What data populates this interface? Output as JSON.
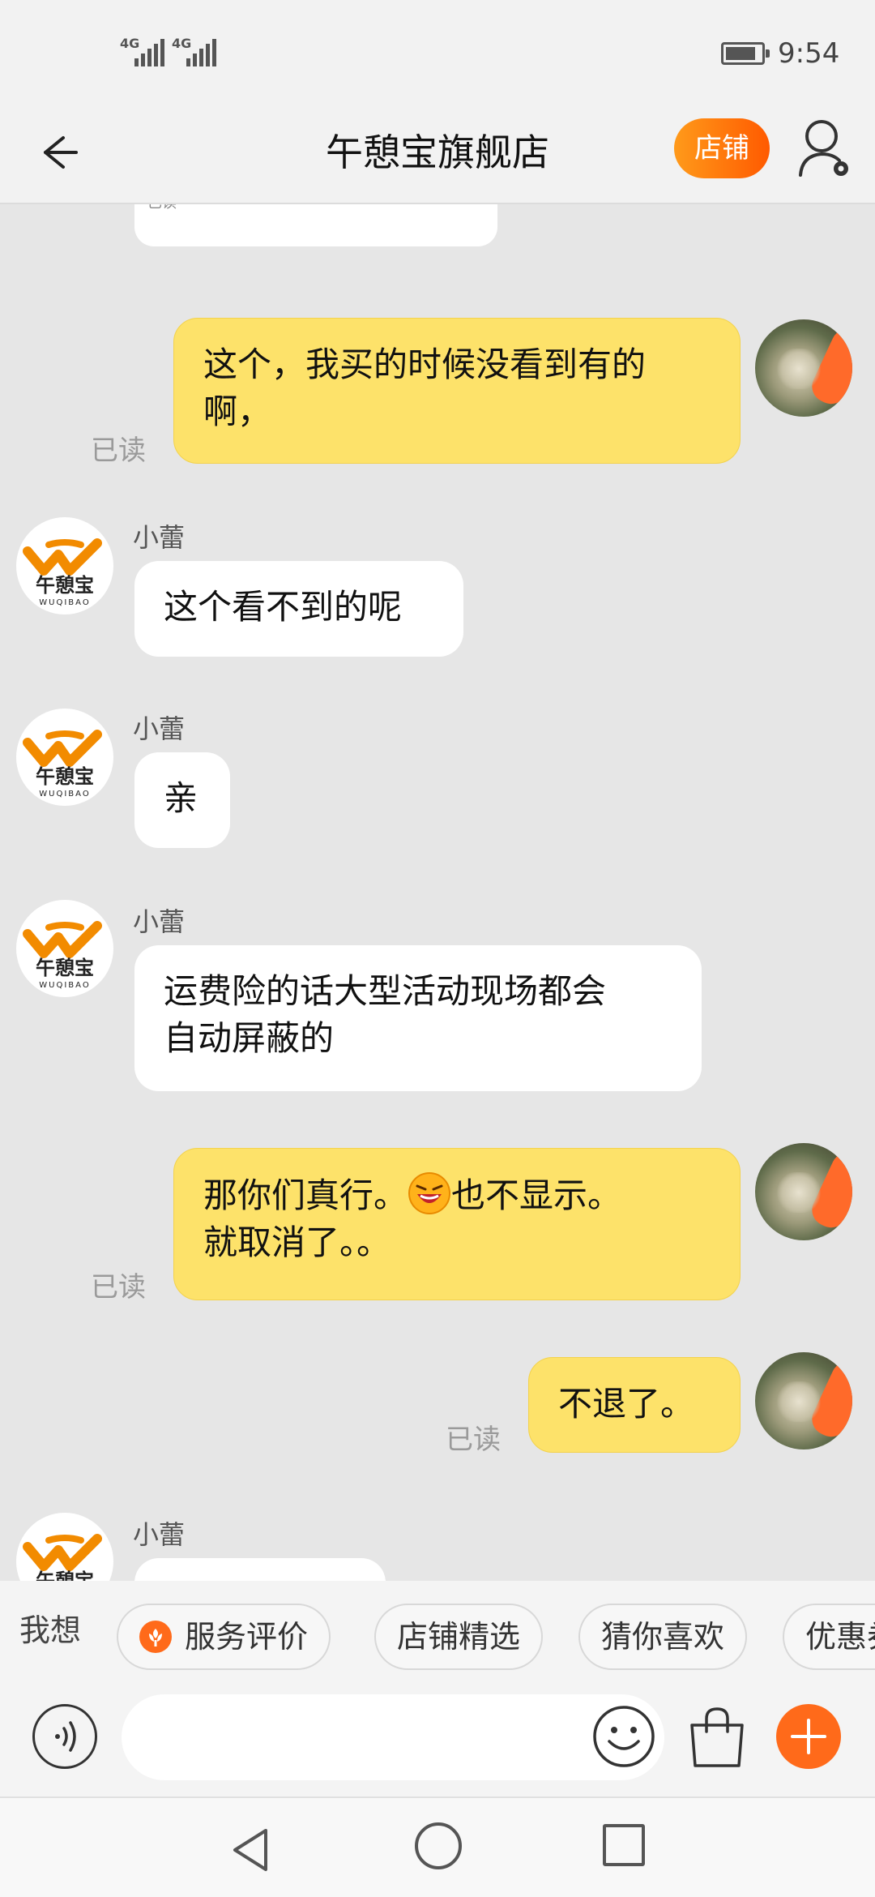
{
  "status": {
    "time": "9:54",
    "network_1": "4G",
    "network_2": "4G"
  },
  "header": {
    "title": "午憩宝旗舰店",
    "shop_button": "店铺"
  },
  "chat": {
    "prev_image_caption": "已读",
    "messages": [
      {
        "from": "me",
        "lines": [
          "这个，我买的时候没看到有的",
          "啊，"
        ],
        "read": "已读"
      },
      {
        "from": "them",
        "sender": "小蕾",
        "lines": [
          "这个看不到的呢"
        ]
      },
      {
        "from": "them",
        "sender": "小蕾",
        "lines": [
          "亲"
        ]
      },
      {
        "from": "them",
        "sender": "小蕾",
        "lines": [
          "运费险的话大型活动现场都会",
          "自动屏蔽的"
        ]
      },
      {
        "from": "me",
        "lines": [
          "那你们真行。",
          "也不显示。",
          "就取消了。。"
        ],
        "read": "已读"
      },
      {
        "from": "me",
        "lines": [
          "不退了。"
        ],
        "read": "已读"
      },
      {
        "from": "them",
        "sender": "小蕾",
        "lines": [
          ""
        ]
      }
    ],
    "store_logo_text": "午憩宝",
    "store_logo_subtext": "WUQIBAO"
  },
  "quickbar": {
    "label": "我想",
    "chips": [
      "服务评价",
      "店铺精选",
      "猜你喜欢",
      "优惠券"
    ]
  },
  "colors": {
    "accent": "#ff6a1a",
    "my_bubble": "#fde26a",
    "their_bubble": "#ffffff",
    "background": "#e6e6e6"
  }
}
